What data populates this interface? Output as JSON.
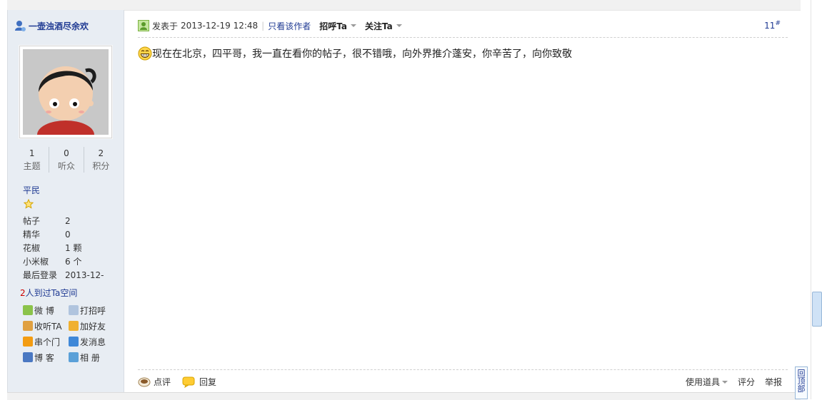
{
  "author": {
    "name": "一壶浊酒尽余欢",
    "stats": [
      {
        "num": "1",
        "label": "主题"
      },
      {
        "num": "0",
        "label": "听众"
      },
      {
        "num": "2",
        "label": "积分"
      }
    ],
    "rank": "平民",
    "props": [
      {
        "k": "帖子",
        "v": "2"
      },
      {
        "k": "精华",
        "v": "0"
      },
      {
        "k": "花椒",
        "v": "1 颗"
      },
      {
        "k": "小米椒",
        "v": "6 个"
      },
      {
        "k": "最后登录",
        "v": "2013-12-"
      }
    ],
    "visited_count": "2",
    "visited_text": "人到过Ta空间",
    "actions": [
      {
        "label": "微 博",
        "icon": "weibo-icon",
        "color": "#8bc34a"
      },
      {
        "label": "打招呼",
        "icon": "wave-icon",
        "color": "#b0c4de"
      },
      {
        "label": "收听TA",
        "icon": "listen-icon",
        "color": "#e0a040"
      },
      {
        "label": "加好友",
        "icon": "handshake-icon",
        "color": "#f0b030"
      },
      {
        "label": "串个门",
        "icon": "home-icon",
        "color": "#f39c12"
      },
      {
        "label": "发消息",
        "icon": "mail-icon",
        "color": "#3f88d8"
      },
      {
        "label": "博 客",
        "icon": "blog-icon",
        "color": "#4a78c2"
      },
      {
        "label": "相 册",
        "icon": "album-icon",
        "color": "#5aa0d8"
      }
    ]
  },
  "post": {
    "posted_prefix": "发表于",
    "posted_time": "2013-12-19 12:48",
    "only_author": "只看该作者",
    "greet": "招呼Ta",
    "follow": "关注Ta",
    "floor": "11",
    "floor_mark": "#",
    "content": "现在在北京，四平哥，我一直在看你的帖子，很不错哦，向外界推介蓬安，你辛苦了，向你致敬"
  },
  "footer": {
    "comment": "点评",
    "reply": "回复",
    "use_tool": "使用道具",
    "rate": "评分",
    "report": "举报"
  },
  "back_to_top": "回顶部"
}
